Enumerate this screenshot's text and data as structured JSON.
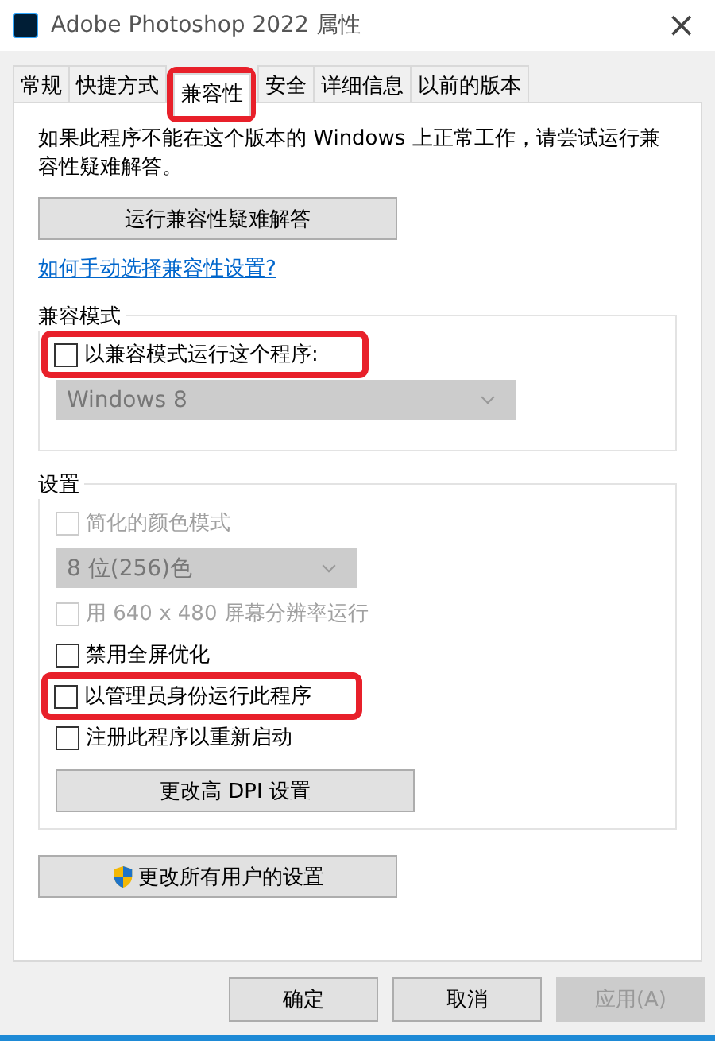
{
  "window": {
    "title": "Adobe Photoshop 2022 属性",
    "close": "×"
  },
  "tabs": [
    {
      "label": "常规",
      "selected": false,
      "highlighted": false
    },
    {
      "label": "快捷方式",
      "selected": false,
      "highlighted": false
    },
    {
      "label": "兼容性",
      "selected": true,
      "highlighted": true
    },
    {
      "label": "安全",
      "selected": false,
      "highlighted": false
    },
    {
      "label": "详细信息",
      "selected": false,
      "highlighted": false
    },
    {
      "label": "以前的版本",
      "selected": false,
      "highlighted": false
    }
  ],
  "intro": "如果此程序不能在这个版本的 Windows 上正常工作，请尝试运行兼容性疑难解答。",
  "troubleshoot_button": "运行兼容性疑难解答",
  "help_link": "如何手动选择兼容性设置?",
  "groups": [
    {
      "legend": "兼容模式",
      "items": [
        {
          "kind": "checkbox",
          "label": "以兼容模式运行这个程序:",
          "checked": false,
          "disabled": false,
          "highlighted": true
        },
        {
          "kind": "dropdown",
          "value": "Windows 8",
          "disabled": true
        }
      ]
    },
    {
      "legend": "设置",
      "items": [
        {
          "kind": "checkbox",
          "label": "简化的颜色模式",
          "checked": false,
          "disabled": true,
          "highlighted": false
        },
        {
          "kind": "dropdown",
          "value": "8 位(256)色",
          "disabled": true
        },
        {
          "kind": "checkbox",
          "label": "用 640 x 480 屏幕分辨率运行",
          "checked": false,
          "disabled": true,
          "highlighted": false
        },
        {
          "kind": "checkbox",
          "label": "禁用全屏优化",
          "checked": false,
          "disabled": false,
          "highlighted": false
        },
        {
          "kind": "checkbox",
          "label": "以管理员身份运行此程序",
          "checked": false,
          "disabled": false,
          "highlighted": true
        },
        {
          "kind": "checkbox",
          "label": "注册此程序以重新启动",
          "checked": false,
          "disabled": false,
          "highlighted": false
        },
        {
          "kind": "button",
          "label": "更改高 DPI 设置"
        }
      ]
    }
  ],
  "all_users_button": "更改所有用户的设置",
  "footer_buttons": [
    {
      "label": "确定",
      "disabled": false
    },
    {
      "label": "取消",
      "disabled": false
    },
    {
      "label": "应用(A)",
      "disabled": true
    }
  ]
}
